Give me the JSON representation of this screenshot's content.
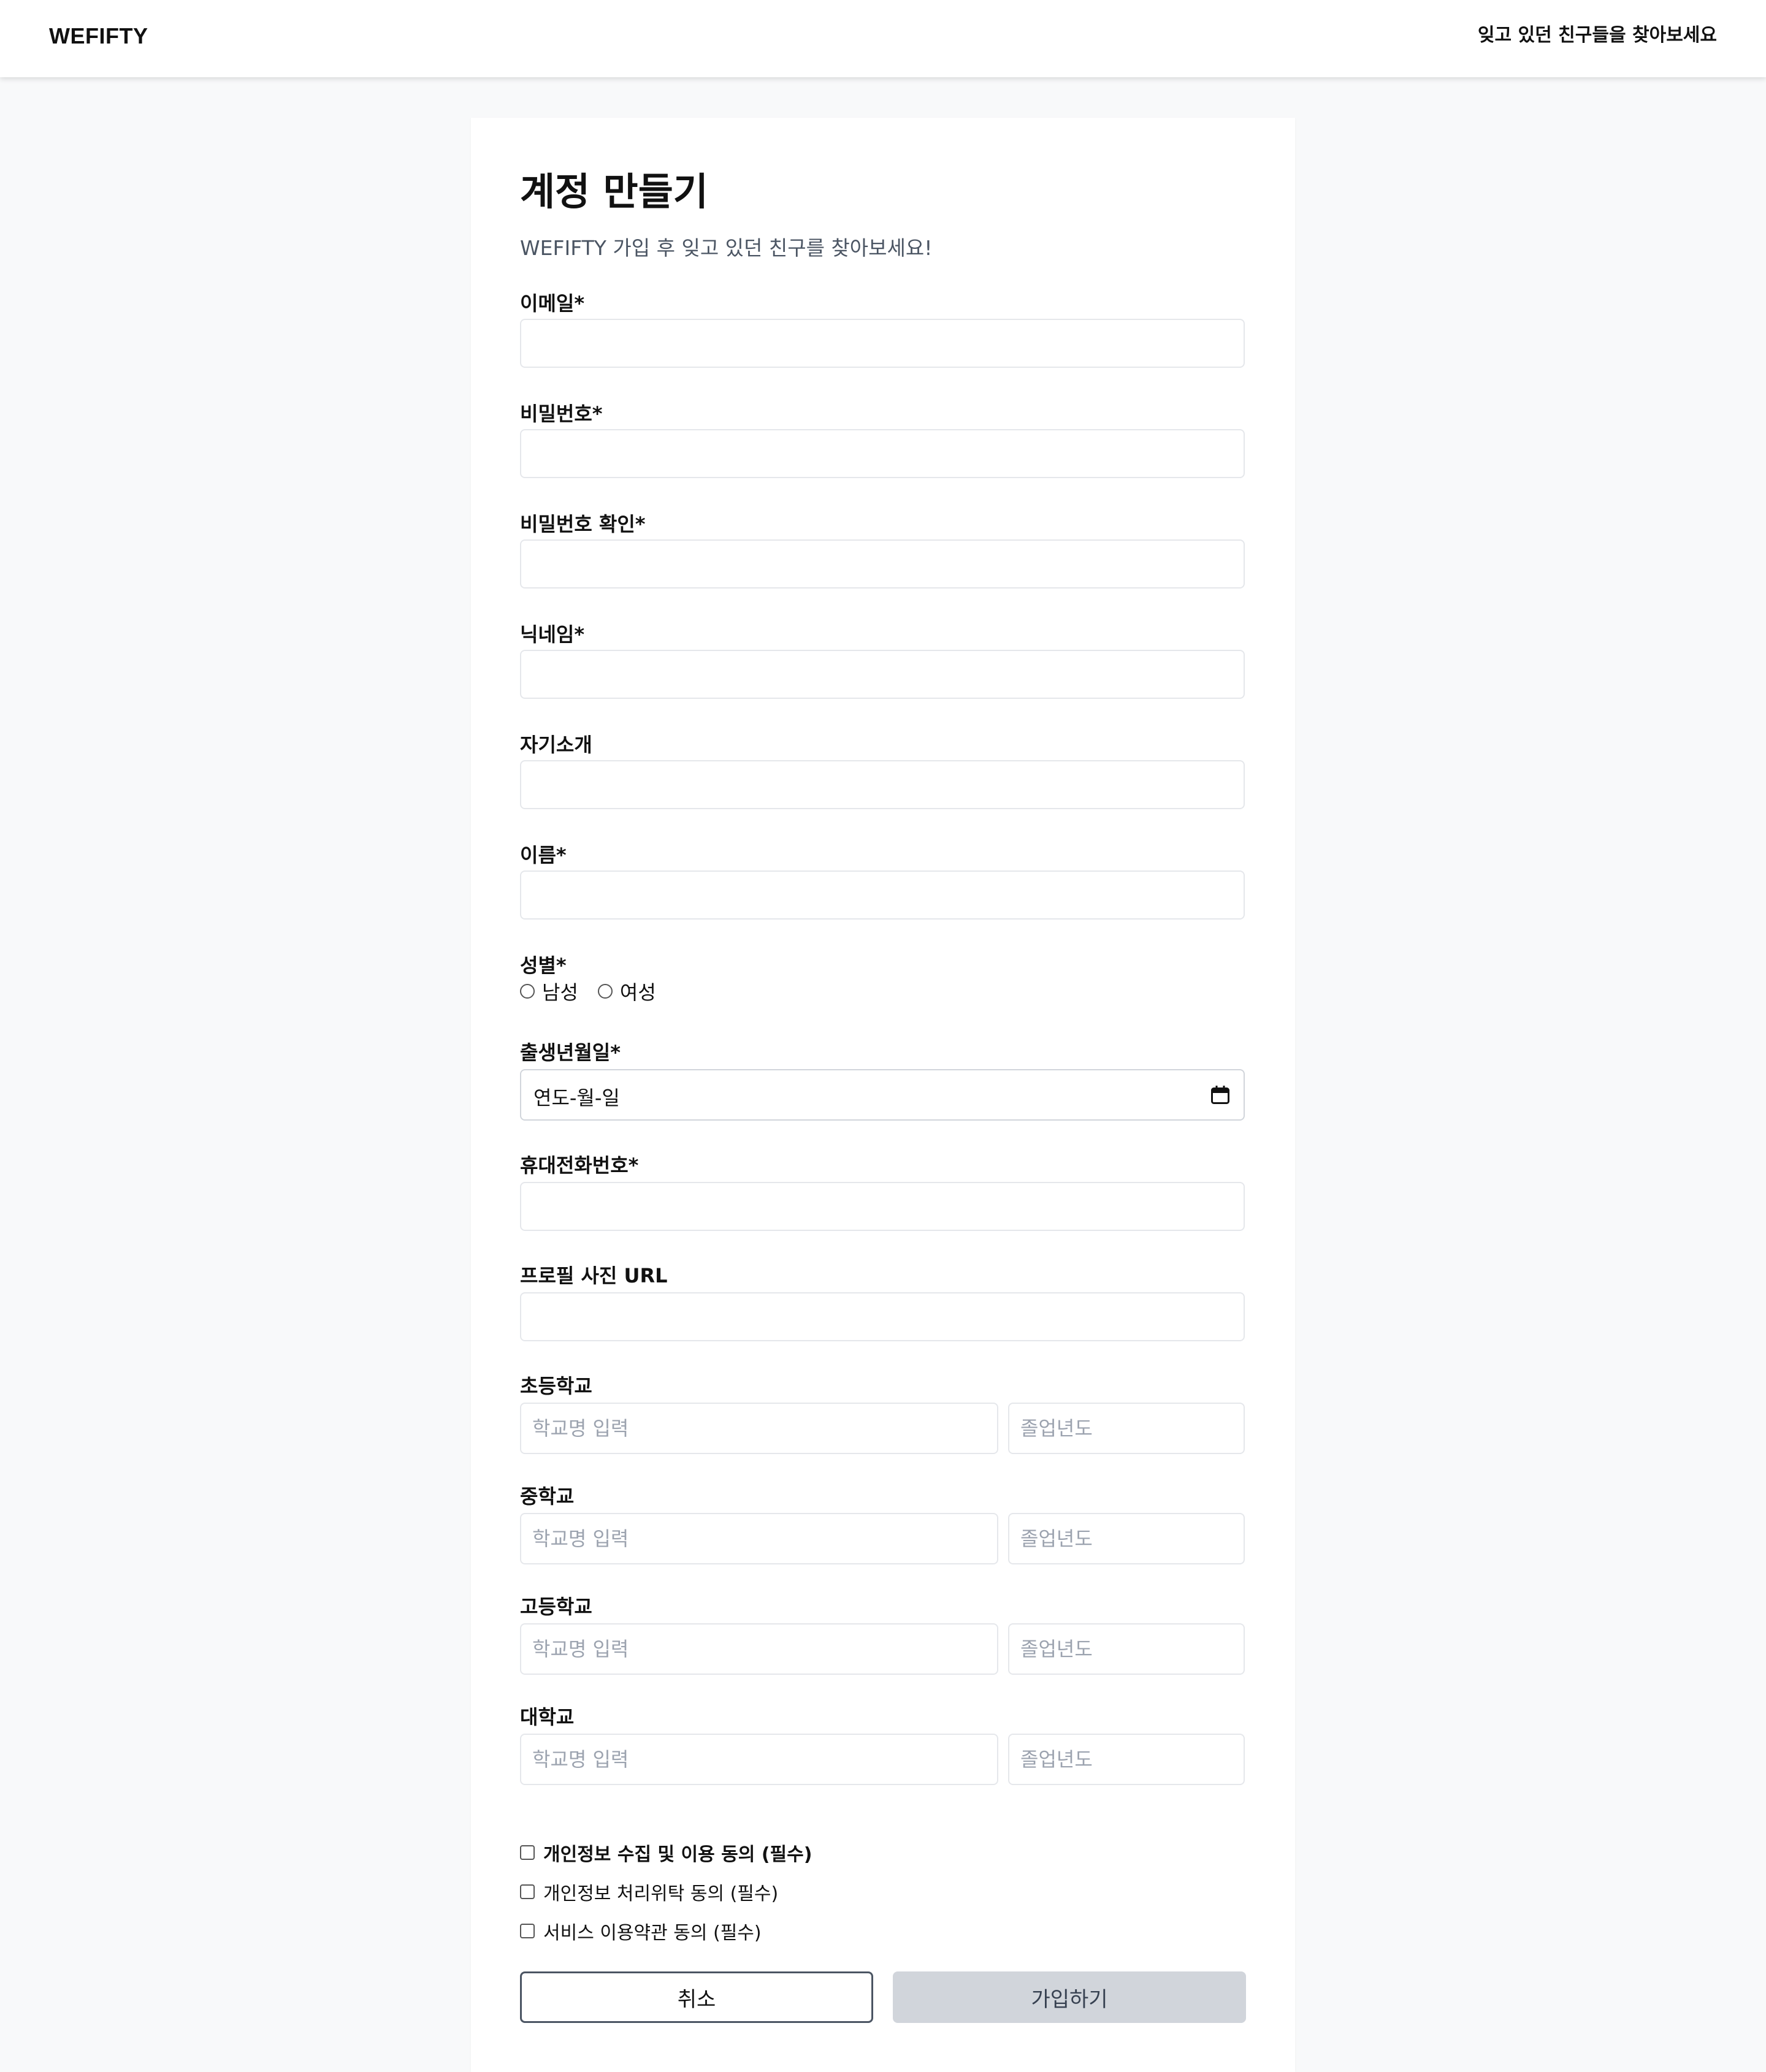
{
  "header": {
    "brand": "WEFIFTY",
    "tagline": "잊고 있던 친구들을 찾아보세요"
  },
  "form": {
    "title": "계정 만들기",
    "subtitle": "WEFIFTY 가입 후 잊고 있던 친구를 찾아보세요!",
    "fields": {
      "email": "이메일*",
      "password": "비밀번호*",
      "password_confirm": "비밀번호 확인*",
      "nickname": "닉네임*",
      "bio": "자기소개",
      "name": "이름*",
      "gender": "성별*",
      "birthdate": "출생년월일*",
      "phone": "휴대전화번호*",
      "profile_url": "프로필 사진 URL"
    },
    "gender_options": [
      "남성",
      "여성"
    ],
    "birthdate_value": "연도-월-일",
    "schools": [
      {
        "label": "초등학교",
        "name_placeholder": "학교명 입력",
        "year_placeholder": "졸업년도"
      },
      {
        "label": "중학교",
        "name_placeholder": "학교명 입력",
        "year_placeholder": "졸업년도"
      },
      {
        "label": "고등학교",
        "name_placeholder": "학교명 입력",
        "year_placeholder": "졸업년도"
      },
      {
        "label": "대학교",
        "name_placeholder": "학교명 입력",
        "year_placeholder": "졸업년도"
      }
    ],
    "agreements": [
      "개인정보 수집 및 이용 동의 (필수)",
      "개인정보 처리위탁 동의 (필수)",
      "서비스 이용약관 동의 (필수)"
    ],
    "buttons": {
      "cancel": "취소",
      "submit": "가입하기"
    }
  }
}
